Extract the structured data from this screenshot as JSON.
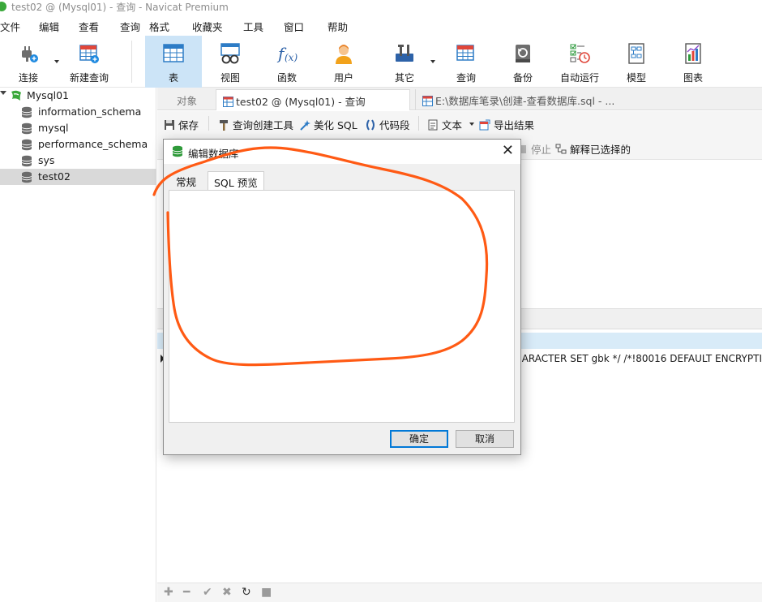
{
  "window": {
    "title": "test02 @ (Mysql01) - 查询 - Navicat Premium"
  },
  "menubar": [
    "文件",
    "编辑",
    "查看",
    "查询",
    "格式",
    "收藏夹",
    "工具",
    "窗口",
    "帮助"
  ],
  "toolbar": {
    "connect": "连接",
    "new_query": "新建查询",
    "table": "表",
    "view": "视图",
    "function": "函数",
    "user": "用户",
    "other": "其它",
    "query": "查询",
    "backup": "备份",
    "auto_run": "自动运行",
    "model": "模型",
    "chart": "图表"
  },
  "sidebar": {
    "connection": "Mysql01",
    "databases": [
      "information_schema",
      "mysql",
      "performance_schema",
      "sys",
      "test02"
    ],
    "selected": "test02"
  },
  "tabs": {
    "objects": "对象",
    "query_tab": "test02 @ (Mysql01) - 查询",
    "file_tab": "E:\\数据库笔录\\创建-查看数据库.sql - ..."
  },
  "query_toolbar": {
    "save": "保存",
    "query_builder": "查询创建工具",
    "beautify": "美化 SQL",
    "snippet": "代码段",
    "text": "文本",
    "export": "导出结果"
  },
  "run_toolbar": {
    "stop": "停止",
    "explain": "解释已选择的"
  },
  "result": {
    "row_text": "HARACTER SET gbk */ /*!80016 DEFAULT ENCRYPTI"
  },
  "dialog": {
    "title": "编辑数据库",
    "tabs": [
      "常规",
      "SQL 预览"
    ],
    "active_tab": "SQL 预览",
    "ok": "确定",
    "cancel": "取消"
  },
  "colors": {
    "accent_selected": "#cce4f7",
    "annotation_stroke": "#ff5a14",
    "db_icon": "#6b6b6b",
    "primary_button_border": "#0078d7"
  },
  "icons": {
    "connect": "plug-icon",
    "new_query": "grid-plus-icon",
    "table": "table-grid-icon",
    "view": "glasses-icon",
    "function": "fx-icon",
    "user": "user-icon",
    "other": "tools-icon",
    "query": "query-grid-icon",
    "backup": "backup-icon",
    "auto_run": "checklist-clock-icon",
    "model": "model-icon",
    "chart": "chart-icon"
  }
}
